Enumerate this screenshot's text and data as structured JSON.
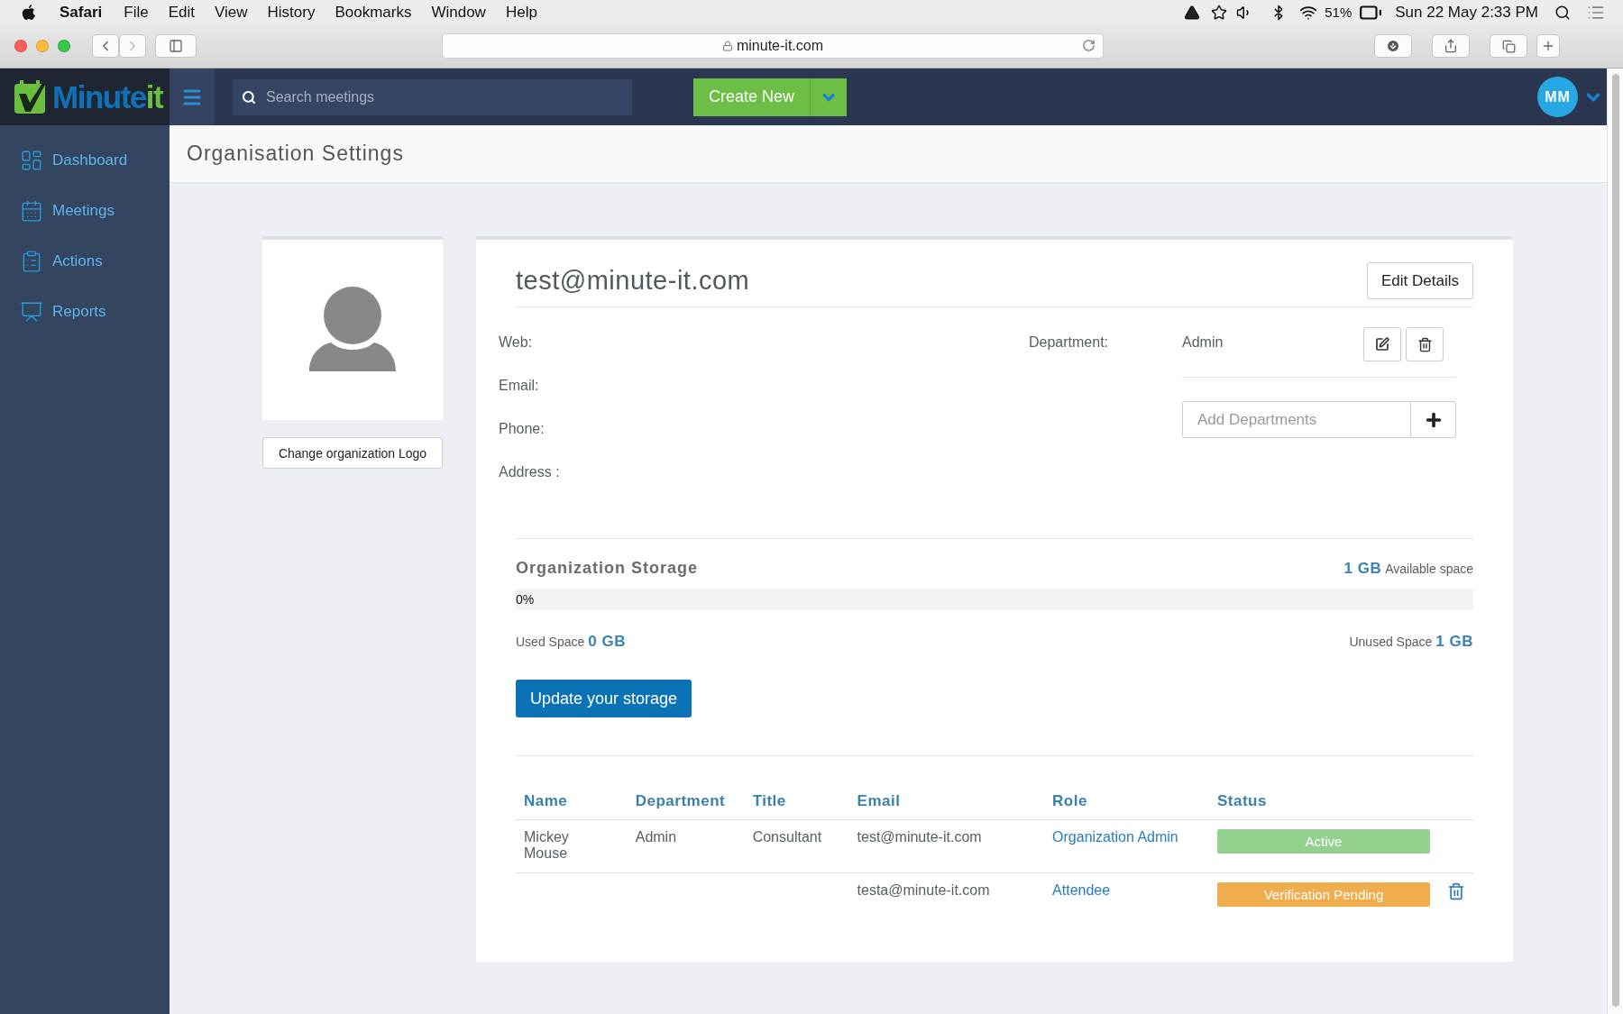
{
  "menubar": {
    "app": "Safari",
    "menus": [
      "File",
      "Edit",
      "View",
      "History",
      "Bookmarks",
      "Window",
      "Help"
    ],
    "battery": "51%",
    "clock": "Sun 22 May  2:33 PM"
  },
  "browser": {
    "url": "minute-it.com"
  },
  "header": {
    "logo": {
      "main": "Minute",
      "accent": "it"
    },
    "search": {
      "placeholder": "Search meetings"
    },
    "create_button": "Create New",
    "avatar": "MM"
  },
  "sidebar": {
    "items": [
      {
        "label": "Dashboard",
        "kind": "dashboard"
      },
      {
        "label": "Meetings",
        "kind": "meetings"
      },
      {
        "label": "Actions",
        "kind": "actions"
      },
      {
        "label": "Reports",
        "kind": "reports"
      }
    ]
  },
  "page_title": "Organisation Settings",
  "logo_panel": {
    "button": "Change organization Logo"
  },
  "org": {
    "name": "test@minute-it.com",
    "edit_button": "Edit Details",
    "fields": [
      {
        "label": "Web:"
      },
      {
        "label": "Email:"
      },
      {
        "label": "Phone:"
      },
      {
        "label": "Address :"
      }
    ],
    "department": {
      "label": "Department:",
      "value": "Admin"
    },
    "add_department": {
      "placeholder": "Add Departments"
    }
  },
  "storage": {
    "title": "Organization Storage",
    "available": {
      "value": "1 GB",
      "label": "Available space"
    },
    "level": 0,
    "percent": "0%",
    "used": {
      "label": "Used Space",
      "value": "0 GB"
    },
    "unused": {
      "label": "Unused Space",
      "value": "1 GB"
    },
    "button": "Update your storage"
  },
  "table": {
    "columns": [
      "Name",
      "Department",
      "Title",
      "Email",
      "Role",
      "Status"
    ],
    "rows": [
      {
        "name": "Mickey Mouse",
        "department": "Admin",
        "title": "Consultant",
        "email": "test@minute-it.com",
        "role": "Organization Admin",
        "status": "Active",
        "color": "#94d18f",
        "deletable": false
      },
      {
        "email": "testa@minute-it.com",
        "role": "Attendee",
        "status": "Verification Pending",
        "color": "#f0ad4e",
        "deletable": true
      }
    ]
  }
}
